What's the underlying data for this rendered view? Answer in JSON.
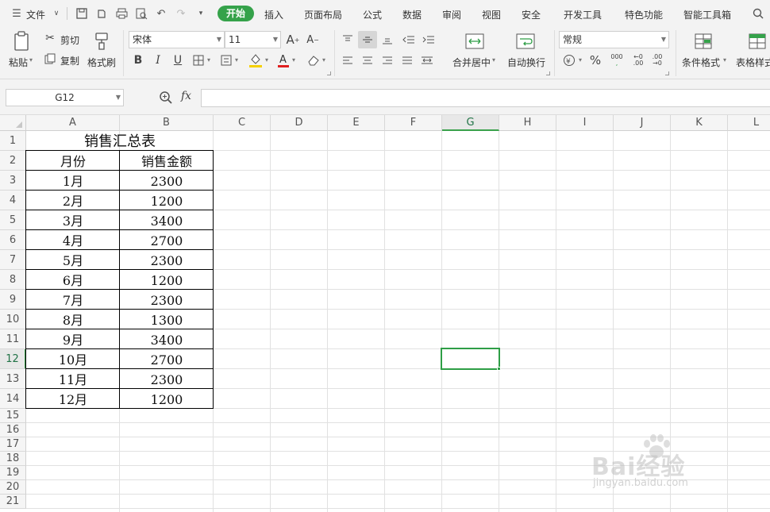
{
  "menu": {
    "file_label": "文件",
    "tabs": [
      "开始",
      "插入",
      "页面布局",
      "公式",
      "数据",
      "审阅",
      "视图",
      "安全",
      "开发工具",
      "特色功能",
      "智能工具箱"
    ],
    "active_tab": "开始"
  },
  "ribbon": {
    "paste": "粘贴",
    "cut": "剪切",
    "copy": "复制",
    "format_painter": "格式刷",
    "font_name": "宋体",
    "font_size": "11",
    "merge_center": "合并居中",
    "wrap_text": "自动换行",
    "number_format": "常规",
    "conditional_format": "条件格式",
    "table_style": "表格样式"
  },
  "formula_bar": {
    "name_box": "G12",
    "fx": "fx",
    "formula": ""
  },
  "grid": {
    "columns": [
      "A",
      "B",
      "C",
      "D",
      "E",
      "F",
      "G",
      "H",
      "I",
      "J",
      "K",
      "L"
    ],
    "rows": [
      "1",
      "2",
      "3",
      "4",
      "5",
      "6",
      "7",
      "8",
      "9",
      "10",
      "11",
      "12",
      "13",
      "14",
      "15",
      "16",
      "17",
      "18",
      "19",
      "20",
      "21"
    ],
    "selected_cell": "G12",
    "selected_column": "G",
    "selected_row": "12"
  },
  "table": {
    "title": "销售汇总表",
    "headers": [
      "月份",
      "销售金额"
    ],
    "rows": [
      [
        "1月",
        "2300"
      ],
      [
        "2月",
        "1200"
      ],
      [
        "3月",
        "3400"
      ],
      [
        "4月",
        "2700"
      ],
      [
        "5月",
        "2300"
      ],
      [
        "6月",
        "1200"
      ],
      [
        "7月",
        "2300"
      ],
      [
        "8月",
        "1300"
      ],
      [
        "9月",
        "3400"
      ],
      [
        "10月",
        "2700"
      ],
      [
        "11月",
        "2300"
      ],
      [
        "12月",
        "1200"
      ]
    ]
  },
  "watermark": {
    "brand": "Bai经验",
    "url": "jingyan.baidu.com"
  },
  "colors": {
    "accent_green": "#35a24a",
    "selection_green": "#2e9e46",
    "toolbar_bg": "#f3f3f3",
    "font_color_red": "#e02020",
    "highlight_yellow": "#f5d000"
  }
}
